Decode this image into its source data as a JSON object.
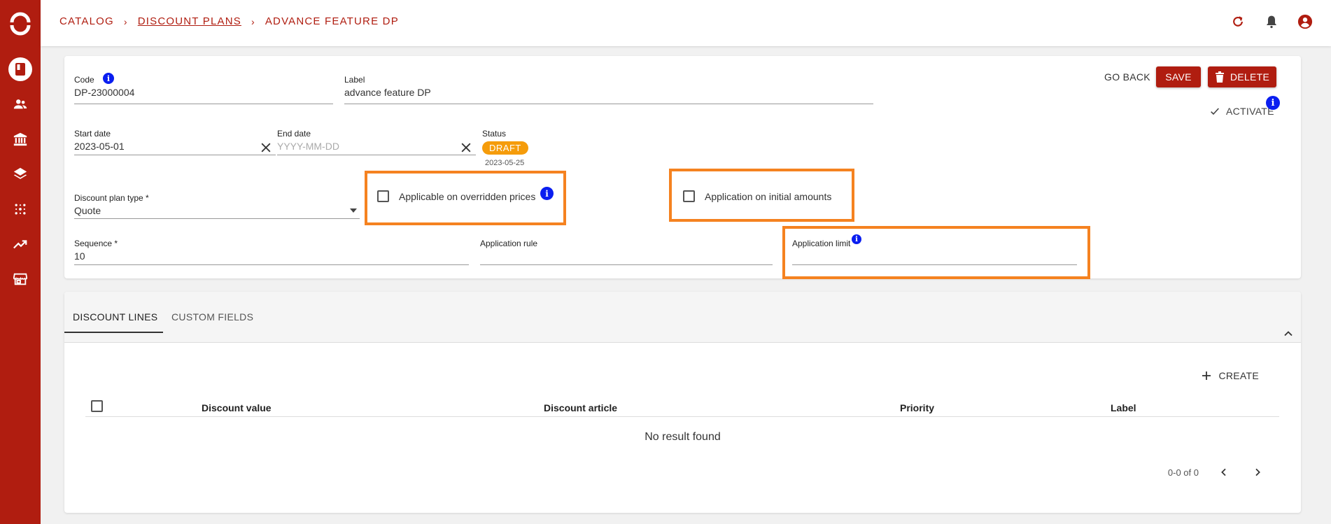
{
  "breadcrumb": {
    "catalog": "CATALOG",
    "discount_plans": "DISCOUNT PLANS",
    "current": "ADVANCE FEATURE DP"
  },
  "sidebar": {
    "items": [
      {
        "icon": "book-icon",
        "active": true
      },
      {
        "icon": "people-icon"
      },
      {
        "icon": "bank-icon"
      },
      {
        "icon": "layers-icon"
      },
      {
        "icon": "grid-dots-icon"
      },
      {
        "icon": "trending-up-icon"
      },
      {
        "icon": "store-icon"
      }
    ]
  },
  "topbar_icons": [
    "refresh-icon",
    "bell-icon",
    "account-circle-icon"
  ],
  "actions": {
    "go_back": "GO BACK",
    "save": "SAVE",
    "delete": "DELETE",
    "activate": "ACTIVATE"
  },
  "form": {
    "code": {
      "label": "Code",
      "value": "DP-23000004"
    },
    "label": {
      "label": "Label",
      "value": "advance feature DP"
    },
    "start_date": {
      "label": "Start date",
      "value": "2023-05-01"
    },
    "end_date": {
      "label": "End date",
      "placeholder": "YYYY-MM-DD"
    },
    "status": {
      "label": "Status",
      "value": "DRAFT",
      "date": "2023-05-25"
    },
    "discount_plan_type": {
      "label": "Discount plan type *",
      "value": "Quote"
    },
    "applicable_overridden": {
      "label": "Applicable on overridden prices",
      "checked": false
    },
    "application_initial": {
      "label": "Application on initial amounts",
      "checked": false
    },
    "sequence": {
      "label": "Sequence *",
      "value": "10"
    },
    "application_rule": {
      "label": "Application rule",
      "value": ""
    },
    "application_limit": {
      "label": "Application limit",
      "value": ""
    }
  },
  "tabs": [
    {
      "label": "DISCOUNT LINES",
      "active": true
    },
    {
      "label": "CUSTOM FIELDS",
      "active": false
    }
  ],
  "lines": {
    "create_label": "CREATE",
    "columns": [
      "Discount value",
      "Discount article",
      "Priority",
      "Label"
    ],
    "empty_message": "No result found",
    "pagination": "0-0 of 0"
  },
  "colors": {
    "brand": "#b01d10",
    "highlight": "#f58220",
    "status_draft": "#f59c0b",
    "info": "#0a1ef0"
  }
}
